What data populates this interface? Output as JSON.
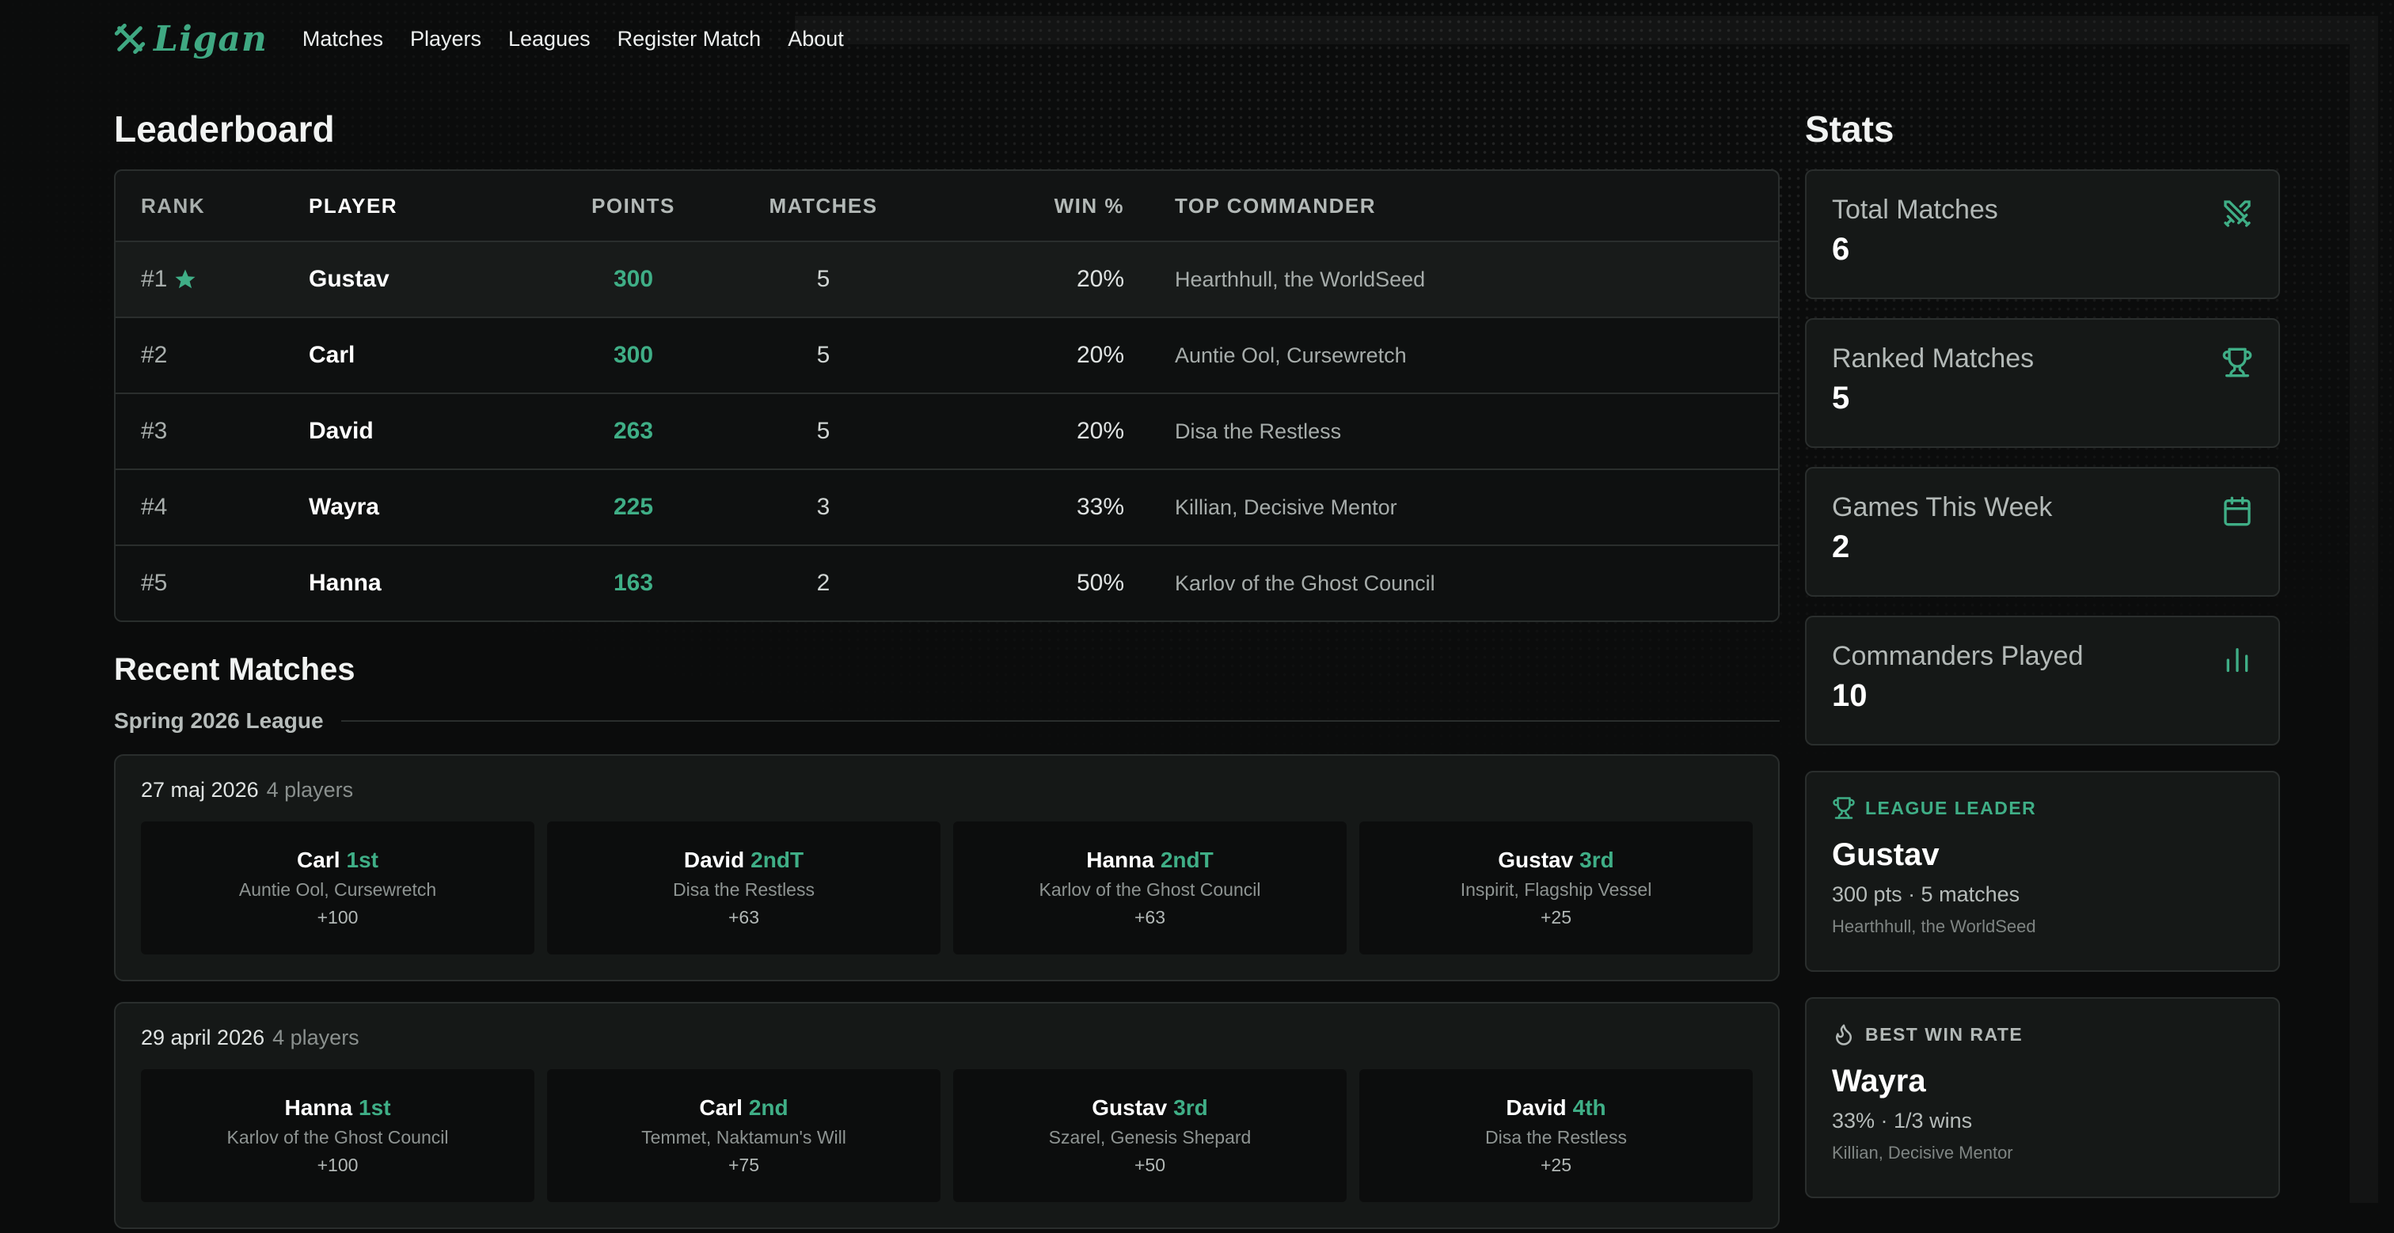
{
  "nav": {
    "brand": "Ligan",
    "links": [
      "Matches",
      "Players",
      "Leagues",
      "Register Match",
      "About"
    ]
  },
  "leaderboard": {
    "title": "Leaderboard",
    "headers": {
      "rank": "RANK",
      "player": "PLAYER",
      "points": "POINTS",
      "matches": "MATCHES",
      "win": "WIN %",
      "commander": "TOP COMMANDER"
    },
    "rows": [
      {
        "rank": "#1",
        "player": "Gustav",
        "points": "300",
        "matches": "5",
        "win": "20%",
        "commander": "Hearthhull, the WorldSeed"
      },
      {
        "rank": "#2",
        "player": "Carl",
        "points": "300",
        "matches": "5",
        "win": "20%",
        "commander": "Auntie Ool, Cursewretch"
      },
      {
        "rank": "#3",
        "player": "David",
        "points": "263",
        "matches": "5",
        "win": "20%",
        "commander": "Disa the Restless"
      },
      {
        "rank": "#4",
        "player": "Wayra",
        "points": "225",
        "matches": "3",
        "win": "33%",
        "commander": "Killian, Decisive Mentor"
      },
      {
        "rank": "#5",
        "player": "Hanna",
        "points": "163",
        "matches": "2",
        "win": "50%",
        "commander": "Karlov of the Ghost Council"
      }
    ]
  },
  "recent": {
    "title": "Recent Matches",
    "league": "Spring 2026 League",
    "matches": [
      {
        "date": "27 maj 2026",
        "players": "4 players",
        "results": [
          {
            "name": "Carl",
            "place": "1st",
            "commander": "Auntie Ool, Cursewretch",
            "points": "+100"
          },
          {
            "name": "David",
            "place": "2ndT",
            "commander": "Disa the Restless",
            "points": "+63"
          },
          {
            "name": "Hanna",
            "place": "2ndT",
            "commander": "Karlov of the Ghost Council",
            "points": "+63"
          },
          {
            "name": "Gustav",
            "place": "3rd",
            "commander": "Inspirit, Flagship Vessel",
            "points": "+25"
          }
        ]
      },
      {
        "date": "29 april 2026",
        "players": "4 players",
        "results": [
          {
            "name": "Hanna",
            "place": "1st",
            "commander": "Karlov of the Ghost Council",
            "points": "+100"
          },
          {
            "name": "Carl",
            "place": "2nd",
            "commander": "Temmet, Naktamun's Will",
            "points": "+75"
          },
          {
            "name": "Gustav",
            "place": "3rd",
            "commander": "Szarel, Genesis Shepard",
            "points": "+50"
          },
          {
            "name": "David",
            "place": "4th",
            "commander": "Disa the Restless",
            "points": "+25"
          }
        ]
      }
    ]
  },
  "stats": {
    "title": "Stats",
    "cards": [
      {
        "label": "Total Matches",
        "value": "6",
        "icon": "swords-icon"
      },
      {
        "label": "Ranked Matches",
        "value": "5",
        "icon": "trophy-icon"
      },
      {
        "label": "Games This Week",
        "value": "2",
        "icon": "calendar-icon"
      },
      {
        "label": "Commanders Played",
        "value": "10",
        "icon": "bar-chart-icon"
      }
    ],
    "leader": {
      "heading": "LEAGUE LEADER",
      "name": "Gustav",
      "meta": "300 pts · 5 matches",
      "commander": "Hearthhull, the WorldSeed",
      "icon": "trophy-icon"
    },
    "best_win": {
      "heading": "BEST WIN RATE",
      "name": "Wayra",
      "meta": "33% · 1/3 wins",
      "commander": "Killian, Decisive Mentor",
      "icon": "flame-icon"
    }
  },
  "colors": {
    "accent": "#3fae86",
    "background": "#0b0c0c",
    "card": "#151817",
    "border": "#2a2e2d"
  }
}
